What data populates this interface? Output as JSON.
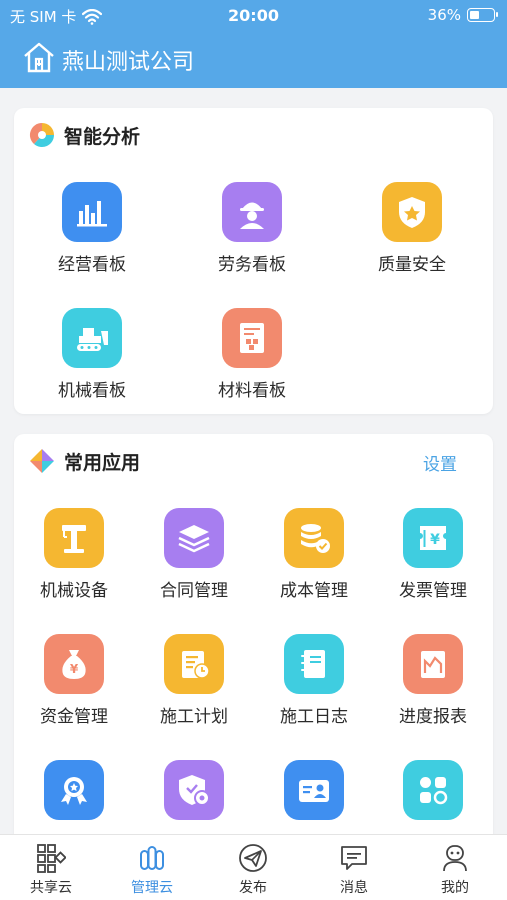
{
  "status_bar": {
    "carrier": "无 SIM 卡",
    "time": "20:00",
    "battery": "36%"
  },
  "header": {
    "title": "燕山测试公司"
  },
  "analysis": {
    "title": "智能分析",
    "items": [
      {
        "label": "经营看板",
        "icon": "bar-chart-icon",
        "color": "#3f8ff0"
      },
      {
        "label": "劳务看板",
        "icon": "worker-icon",
        "color": "#a77ef0"
      },
      {
        "label": "质量安全",
        "icon": "shield-badge-icon",
        "color": "#f5b731"
      },
      {
        "label": "机械看板",
        "icon": "bulldozer-icon",
        "color": "#3fcde0"
      },
      {
        "label": "材料看板",
        "icon": "material-icon",
        "color": "#f28a6e"
      }
    ]
  },
  "apps": {
    "title": "常用应用",
    "action": "设置",
    "items": [
      {
        "label": "机械设备",
        "icon": "crane-icon",
        "color": "#f5b731"
      },
      {
        "label": "合同管理",
        "icon": "layers-icon",
        "color": "#a77ef0"
      },
      {
        "label": "成本管理",
        "icon": "coins-icon",
        "color": "#f5b731"
      },
      {
        "label": "发票管理",
        "icon": "invoice-icon",
        "color": "#3fcde0"
      },
      {
        "label": "资金管理",
        "icon": "money-bag-icon",
        "color": "#f28a6e"
      },
      {
        "label": "施工计划",
        "icon": "plan-icon",
        "color": "#f5b731"
      },
      {
        "label": "施工日志",
        "icon": "notebook-icon",
        "color": "#3fcde0"
      },
      {
        "label": "进度报表",
        "icon": "report-icon",
        "color": "#f28a6e"
      },
      {
        "label": "",
        "icon": "award-icon",
        "color": "#3f8ff0"
      },
      {
        "label": "",
        "icon": "shield-gear-icon",
        "color": "#a77ef0"
      },
      {
        "label": "",
        "icon": "id-card-icon",
        "color": "#3f8ff0"
      },
      {
        "label": "",
        "icon": "apps-grid-icon",
        "color": "#3fcde0"
      }
    ]
  },
  "tabs": [
    {
      "label": "共享云",
      "icon": "share-cloud-icon",
      "active": false
    },
    {
      "label": "管理云",
      "icon": "manage-cloud-icon",
      "active": true
    },
    {
      "label": "发布",
      "icon": "publish-icon",
      "active": false
    },
    {
      "label": "消息",
      "icon": "message-icon",
      "active": false
    },
    {
      "label": "我的",
      "icon": "profile-icon",
      "active": false
    }
  ]
}
